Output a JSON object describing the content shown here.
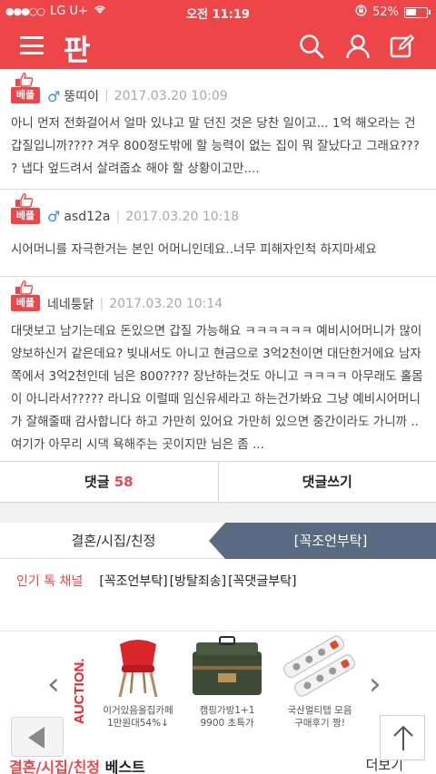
{
  "status_bar": {
    "carrier": "LG U+",
    "time": "오전 11:19",
    "battery": "52%"
  },
  "nav": {
    "logo": "판"
  },
  "comments": [
    {
      "badge": "베플",
      "nickname": "뚱띠이",
      "date": "2017.03.20 10:09",
      "text": "아니 먼저 전화걸어서 얼마 있냐고 말 던진 것은 당찬 일이고... 1억 해오라는 건 갑질입니까???? 겨우 800정도밖에 할 능력이 없는 집이 뭐 잘났다고 그래요??? ? 냅다 엎드려서 살려줍쇼 해야 할 상황이고만...."
    },
    {
      "badge": "베플",
      "nickname": "asd12a",
      "date": "2017.03.20 10:18",
      "text": "시어머니를 자극한거는 본인 어머니인데요..너무 피해자인척 하지마세요"
    },
    {
      "badge": "베플",
      "nickname": "네네퉁닭",
      "date": "2017.03.20 10:14",
      "text": "대댓보고 남기는데요 돈있으면 갑질 가능해요 ㅋㅋㅋㅋㅋㅋ 예비시어머니가 많이 양보하신거 같은데요? 빚내서도 아니고 현금으로 3억2천이면 대단한거에요 남자쪽에서 3억2천인데 님은 800???? 장난하는것도 아니고 ㅋㅋㅋㅋ 아무래도 홀몸이 아니라서????? 라니요 이럴때 임신유세라고 하는건가봐요 그냥 예비시어머니가 잘해줄때 감사합니다 하고 가만히 있어요 가만히 있으면 중간이라도 가니까 .. 여기가 아무리 시댁 욕해주는 곳이지만 님은 좀 ..."
    }
  ],
  "actions": {
    "comments_label": "댓글",
    "comments_count": "58",
    "write_label": "댓글쓰기"
  },
  "category_tabs": {
    "left": "결혼/시집/친정",
    "right": "[꼭조언부탁]"
  },
  "hot_channel": {
    "label": "인기 톡 채널",
    "tags": [
      "[꼭조언부탁]",
      "[방탈죄송]",
      "[꼭댓글부탁]"
    ]
  },
  "ad": {
    "brand": "AUCTION.",
    "products": [
      {
        "name": "이거있음올집카페",
        "price": "1만원대54%↓"
      },
      {
        "name": "캠핑가방1+1",
        "price": "9900 초특가"
      },
      {
        "name": "국산멀티탭 모음",
        "price": "구매후기 짱!"
      }
    ]
  },
  "best": {
    "category": "결혼/시집/친정",
    "label": "베스트",
    "more": "더보기"
  },
  "colors": {
    "brand_red": "#ee4548",
    "tab_active": "#5a6a82",
    "male_blue": "#3a8edc"
  }
}
